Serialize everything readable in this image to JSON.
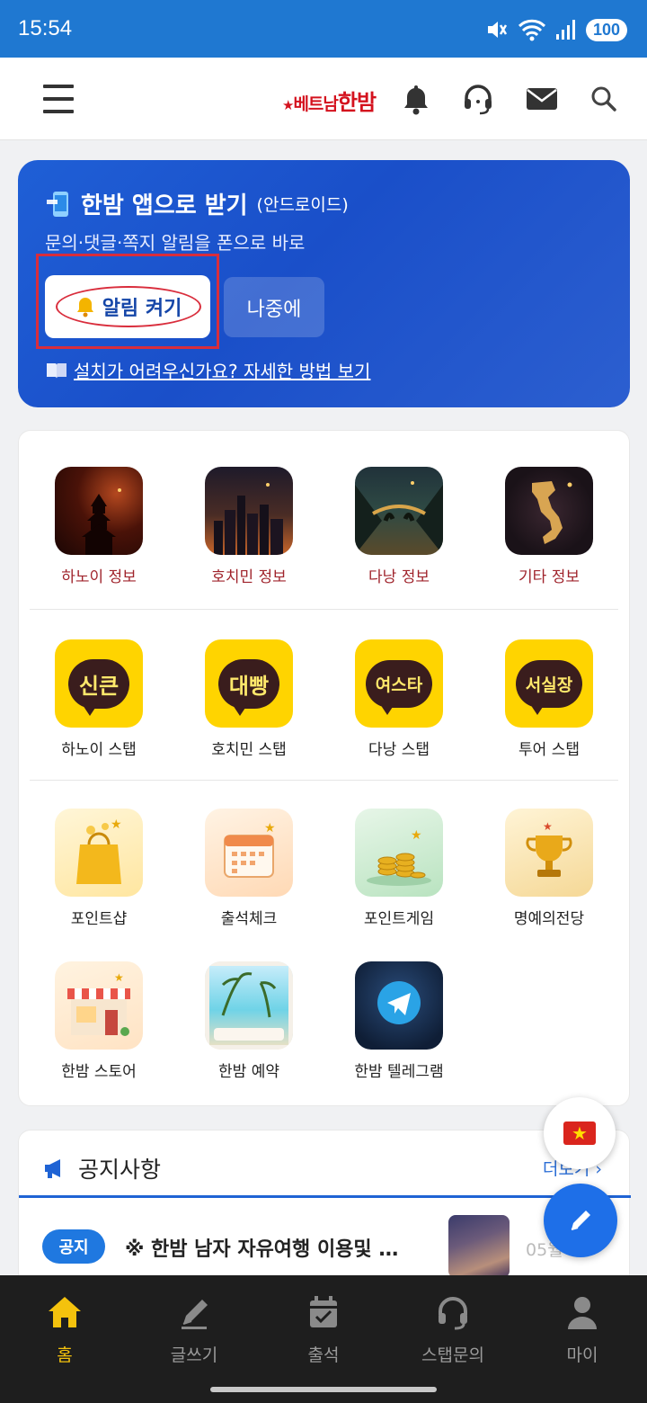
{
  "status_bar": {
    "time": "15:54",
    "battery": "100",
    "network": "6"
  },
  "header": {
    "logo_text_small": "베트남",
    "logo_text_big": "한밤"
  },
  "banner": {
    "title": "한밤 앱으로 받기",
    "title_sub": "(안드로이드)",
    "description": "문의·댓글·쪽지 알림을 폰으로 바로",
    "enable_button": "알림 켜기",
    "later_button": "나중에",
    "help_link": "설치가 어려우신가요? 자세한 방법 보기"
  },
  "menu": {
    "row1": [
      {
        "label": "하노이 정보",
        "icon": "pagoda-night-icon"
      },
      {
        "label": "호치민 정보",
        "icon": "city-skyline-icon"
      },
      {
        "label": "다낭 정보",
        "icon": "golden-bridge-icon"
      },
      {
        "label": "기타 정보",
        "icon": "vietnam-map-icon"
      }
    ],
    "row2": [
      {
        "label": "하노이 스탭",
        "bubble": "신큰"
      },
      {
        "label": "호치민 스탭",
        "bubble": "대빵"
      },
      {
        "label": "다낭 스탭",
        "bubble": "여스타"
      },
      {
        "label": "투어 스탭",
        "bubble": "서실장"
      }
    ],
    "row3": [
      {
        "label": "포인트샵",
        "icon": "shopping-bag-icon"
      },
      {
        "label": "출석체크",
        "icon": "calendar-icon"
      },
      {
        "label": "포인트게임",
        "icon": "coins-icon"
      },
      {
        "label": "명예의전당",
        "icon": "trophy-icon"
      }
    ],
    "row4": [
      {
        "label": "한밤 스토어",
        "icon": "store-icon"
      },
      {
        "label": "한밤 예약",
        "icon": "beach-window-icon"
      },
      {
        "label": "한밤 텔레그램",
        "icon": "telegram-icon"
      }
    ]
  },
  "notice": {
    "title": "공지사항",
    "more": "더보기",
    "badge": "공지",
    "item_title": "※ 한밤 남자 자유여행 이용및 …",
    "item_date": "05월 …"
  },
  "bottom_nav": [
    {
      "label": "홈",
      "icon": "home-icon",
      "active": true
    },
    {
      "label": "글쓰기",
      "icon": "pencil-icon",
      "active": false
    },
    {
      "label": "출석",
      "icon": "calendar-check-icon",
      "active": false
    },
    {
      "label": "스탭문의",
      "icon": "headset-icon",
      "active": false
    },
    {
      "label": "마이",
      "icon": "user-icon",
      "active": false
    }
  ],
  "colors": {
    "accent": "#1f78d1",
    "banner": "#1a4fc9",
    "kakao": "#ffd400",
    "active_nav": "#f4c20d"
  }
}
